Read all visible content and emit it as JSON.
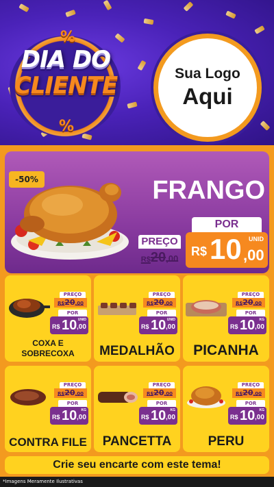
{
  "header": {
    "badge_line1": "DIA DO",
    "badge_line2": "CLIENTE",
    "percent_symbol": "%",
    "logo_line1": "Sua Logo",
    "logo_line2": "Aqui"
  },
  "featured": {
    "discount": "-50%",
    "name": "FRANGO",
    "preco_label": "PREÇO",
    "old_currency": "R$",
    "old_int": "20",
    "old_cents": ",00",
    "por_label": "POR",
    "new_currency": "R$",
    "new_int": "10",
    "new_cents": ",00",
    "unit": "UNID"
  },
  "products": [
    {
      "name_line1": "COXA E",
      "name_line2": "SOBRECOXA",
      "preco_label": "PREÇO",
      "old_currency": "R$",
      "old_int": "20",
      "old_cents": ",00",
      "por_label": "POR",
      "new_currency": "R$",
      "new_int": "10",
      "new_cents": ",00",
      "unit": "UNID"
    },
    {
      "name_line1": "MEDALHÃO",
      "preco_label": "PREÇO",
      "old_currency": "R$",
      "old_int": "20",
      "old_cents": ",00",
      "por_label": "POR",
      "new_currency": "R$",
      "new_int": "10",
      "new_cents": ",00",
      "unit": "UNID"
    },
    {
      "name_line1": "PICANHA",
      "preco_label": "PREÇO",
      "old_currency": "R$",
      "old_int": "20",
      "old_cents": ",00",
      "por_label": "POR",
      "new_currency": "R$",
      "new_int": "10",
      "new_cents": ",00",
      "unit": "KG"
    },
    {
      "name_line1": "CONTRA FILE",
      "preco_label": "PREÇO",
      "old_currency": "R$",
      "old_int": "20",
      "old_cents": ",00",
      "por_label": "POR",
      "new_currency": "R$",
      "new_int": "10",
      "new_cents": ",00",
      "unit": "KG"
    },
    {
      "name_line1": "PANCETTA",
      "preco_label": "PREÇO",
      "old_currency": "R$",
      "old_int": "20",
      "old_cents": ",00",
      "por_label": "POR",
      "new_currency": "R$",
      "new_int": "10",
      "new_cents": ",00",
      "unit": "KG"
    },
    {
      "name_line1": "PERU",
      "preco_label": "PREÇO",
      "old_currency": "R$",
      "old_int": "20",
      "old_cents": ",00",
      "por_label": "POR",
      "new_currency": "R$",
      "new_int": "10",
      "new_cents": ",00",
      "unit": "KG"
    }
  ],
  "footer": {
    "cta": "Crie seu encarte com este tema!",
    "disclaimer": "*Imagens Meramente Ilustrativas"
  },
  "colors": {
    "header_purple": "#4a22b8",
    "panel_orange": "#f39a1f",
    "card_yellow": "#ffd21f",
    "price_purple": "#7a2f8f",
    "price_orange": "#f6891f"
  }
}
